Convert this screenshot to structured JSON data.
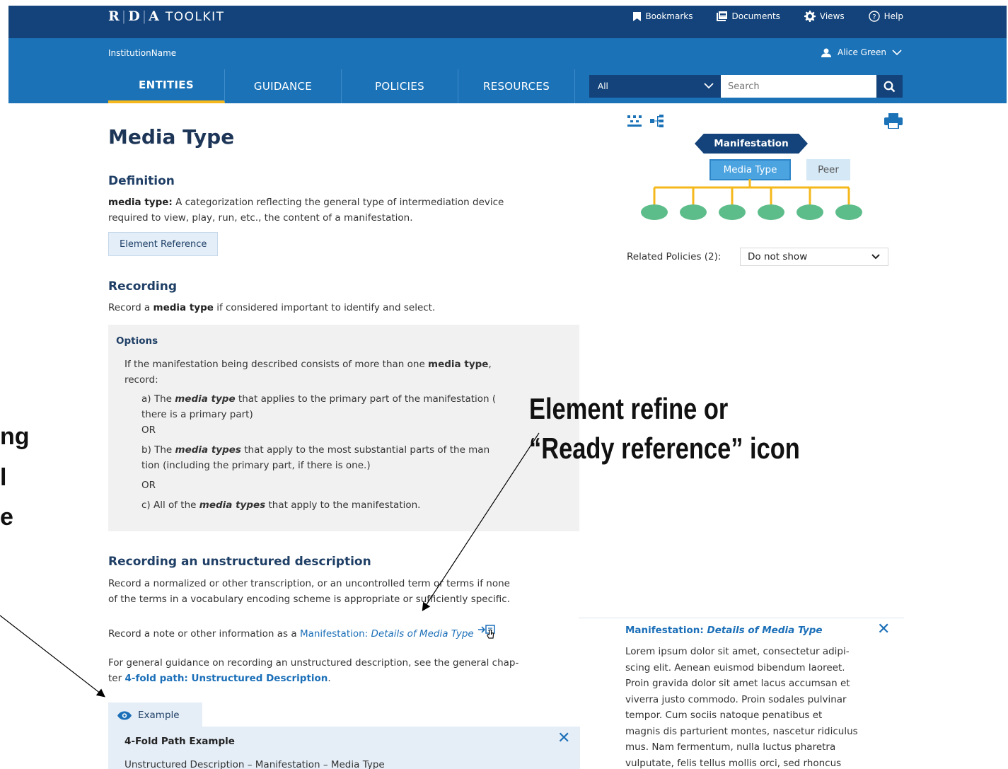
{
  "header": {
    "logo_parts": [
      "R",
      "D",
      "A"
    ],
    "logo_suffix": "TOOLKIT",
    "links": [
      "Bookmarks",
      "Documents",
      "Views",
      "Help"
    ],
    "institution": "InstitutionName",
    "user": "Alice Green"
  },
  "nav": {
    "tabs": [
      "ENTITIES",
      "GUIDANCE",
      "POLICIES",
      "RESOURCES"
    ],
    "active": "ENTITIES",
    "scope_value": "All",
    "search_placeholder": "Search"
  },
  "page": {
    "title": "Media Type",
    "definition_heading": "Definition",
    "definition_term": "media type:",
    "definition_line1": " A categorization reflecting the general type of intermediation device",
    "definition_line2": "required to view, play, run, etc., the content of a manifestation.",
    "element_reference_button": "Element Reference",
    "recording_heading": "Recording",
    "recording_pre": "Record a ",
    "recording_term": "media type",
    "recording_post": " if considered important to identify and select.",
    "options_heading": "Options",
    "options_intro_pre": "If the manifestation being described consists of more than one ",
    "options_intro_term": "media type",
    "options_intro_post": ",",
    "options_intro_line2": "record:",
    "option_a_pre": "a) The ",
    "option_a_term": "media type",
    "option_a_post": " that applies to the primary part of the manifestation (",
    "option_a_line2": "there is a primary part)",
    "or_label": "OR",
    "option_b_pre": "b) The ",
    "option_b_term": "media types",
    "option_b_post": " that apply to the most substantial parts of the man",
    "option_b_line2": "tion (including the primary part, if there is one.)",
    "option_c_pre": "c) All of the ",
    "option_c_term": "media types",
    "option_c_post": " that apply to the manifestation.",
    "unstructured_heading": "Recording an unstructured description",
    "unstructured_line1": "Record a normalized or other transcription, or an uncontrolled term or terms if none",
    "unstructured_line2": "of the terms in a vocabulary encoding scheme is appropriate or sufficiently specific.",
    "note_pre": "Record a note or other information as a ",
    "note_link_prefix": "Manifestation: ",
    "note_link_italic": "Details of Media Type",
    "general_line1": "For general guidance on recording an unstructured description, see the general chap-",
    "general_line2_pre": "ter ",
    "general_link": "4-fold path: Unstructured Description",
    "general_line2_post": "."
  },
  "diagram": {
    "top_node": "Manifestation",
    "current_node": "Media Type",
    "peer_node": "Peer",
    "child_count": 6,
    "related_label": "Related Policies (2):",
    "related_value": "Do not show"
  },
  "callouts": {
    "main_line1": "Element refine or",
    "main_line2": "“Ready reference” icon",
    "left_fragments": [
      "ng",
      "l",
      "e"
    ]
  },
  "example": {
    "tab_label": "Example",
    "title": "4-Fold Path Example",
    "subtitle": "Unstructured Description – Manifestation – Media Type"
  },
  "popup": {
    "title_prefix": "Manifestation: ",
    "title_italic": "Details of Media Type",
    "lines": [
      "Lorem ipsum dolor sit amet, consectetur adipi-",
      "scing elit. Aenean euismod bibendum laoreet.",
      "Proin gravida dolor sit amet lacus accumsan et",
      "viverra justo commodo. Proin sodales pulvinar",
      "tempor. Cum sociis natoque penatibus et",
      "magnis dis parturient montes, nascetur ridiculus",
      "mus. Nam fermentum, nulla luctus pharetra",
      "vulputate, felis tellus mollis orci, sed rhoncus"
    ]
  },
  "colors": {
    "header_dark": "#13437a",
    "header_blue": "#1b72b7",
    "active_underline": "#f5b81c",
    "link": "#1b6fb8",
    "leaf_green": "#5dbd8a",
    "tree_line": "#f5b81c"
  }
}
